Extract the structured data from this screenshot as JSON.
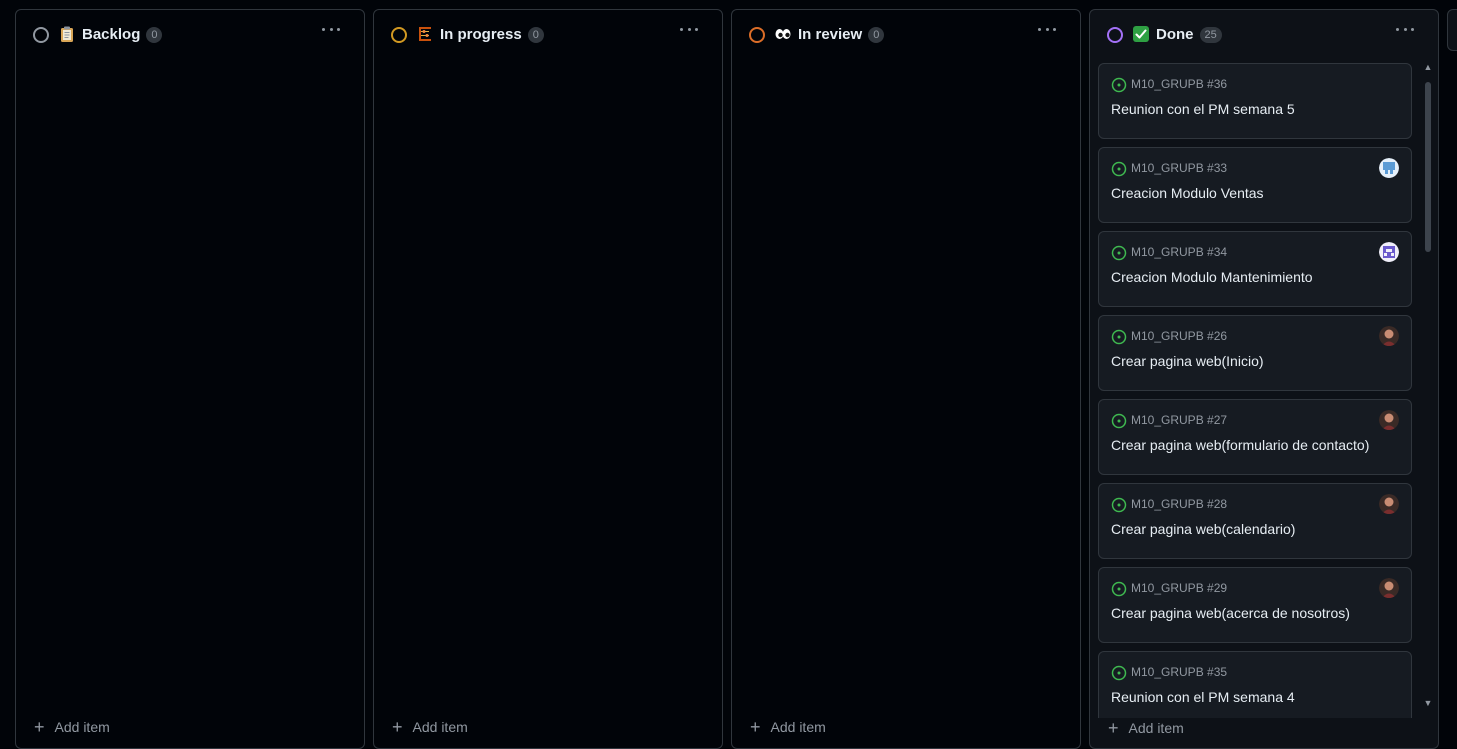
{
  "columns": [
    {
      "title": "Backlog",
      "count": "0",
      "status_color": "#9198a1",
      "emoji": "clipboard-icon"
    },
    {
      "title": "In progress",
      "count": "0",
      "status_color": "#d29922",
      "emoji": "abacus-icon"
    },
    {
      "title": "In review",
      "count": "0",
      "status_color": "#db6d28",
      "emoji": "eyes-icon"
    },
    {
      "title": "Done",
      "count": "25",
      "status_color": "#a371f7",
      "emoji": "check-box-icon"
    }
  ],
  "add_item_label": "Add item",
  "done_cards": [
    {
      "ref": "M10_GRUPB #36",
      "title": "Reunion con el PM semana 5",
      "avatar": ""
    },
    {
      "ref": "M10_GRUPB #33",
      "title": "Creacion Modulo Ventas",
      "avatar": "avatar-blue"
    },
    {
      "ref": "M10_GRUPB #34",
      "title": "Creacion Modulo Mantenimiento",
      "avatar": "avatar-purple"
    },
    {
      "ref": "M10_GRUPB #26",
      "title": "Crear pagina web(Inicio)",
      "avatar": "avatar-photo"
    },
    {
      "ref": "M10_GRUPB #27",
      "title": "Crear pagina web(formulario de contacto)",
      "avatar": "avatar-photo"
    },
    {
      "ref": "M10_GRUPB #28",
      "title": "Crear pagina web(calendario)",
      "avatar": "avatar-photo"
    },
    {
      "ref": "M10_GRUPB #29",
      "title": "Crear pagina web(acerca de nosotros)",
      "avatar": "avatar-photo"
    },
    {
      "ref": "M10_GRUPB #35",
      "title": "Reunion con el PM semana 4",
      "avatar": ""
    }
  ],
  "colors": {
    "background": "#010409",
    "card": "#161b22",
    "border": "#30363d",
    "open_issue": "#3fb950"
  }
}
